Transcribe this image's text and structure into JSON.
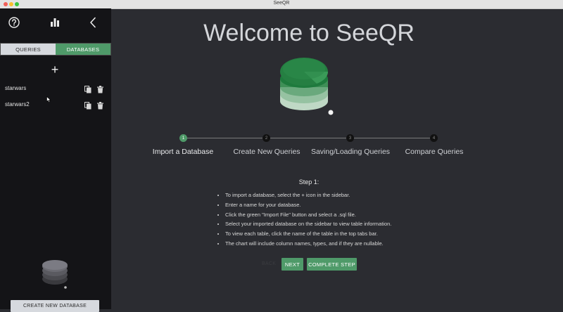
{
  "window": {
    "title": "SeeQR"
  },
  "sidebar": {
    "icons": [
      "help-icon",
      "bar-chart-icon",
      "chevron-left-icon"
    ],
    "tabs": {
      "queries": "QUERIES",
      "databases": "DATABASES",
      "selected": "DATABASES"
    },
    "add_icon": "plus-icon",
    "databases": [
      {
        "name": "starwars"
      },
      {
        "name": "starwars2"
      }
    ],
    "create_button": "CREATE NEW DATABASE"
  },
  "main": {
    "welcome": "Welcome to SeeQR",
    "steps": [
      {
        "number": "1",
        "label": "Import a Database",
        "active": true
      },
      {
        "number": "2",
        "label": "Create New Queries",
        "active": false
      },
      {
        "number": "3",
        "label": "Saving/Loading Queries",
        "active": false
      },
      {
        "number": "4",
        "label": "Compare Queries",
        "active": false
      }
    ],
    "step_title": "Step 1:",
    "instructions": [
      "To import a database, select the + icon in the sidebar.",
      "Enter a name for your database.",
      "Click the green \"Import File\" button and select a .sql file.",
      "Select your imported database on the sidebar to view table information.",
      "To view each table, click the name of the table in the top tabs bar.",
      "The chart will include column names, types, and if they are nullable."
    ],
    "buttons": {
      "back": "BACK",
      "next": "NEXT",
      "complete": "COMPLETE STEP"
    }
  },
  "colors": {
    "accent": "#4f9a69",
    "sidebar_bg": "#141417",
    "main_bg": "#2b2c31"
  }
}
